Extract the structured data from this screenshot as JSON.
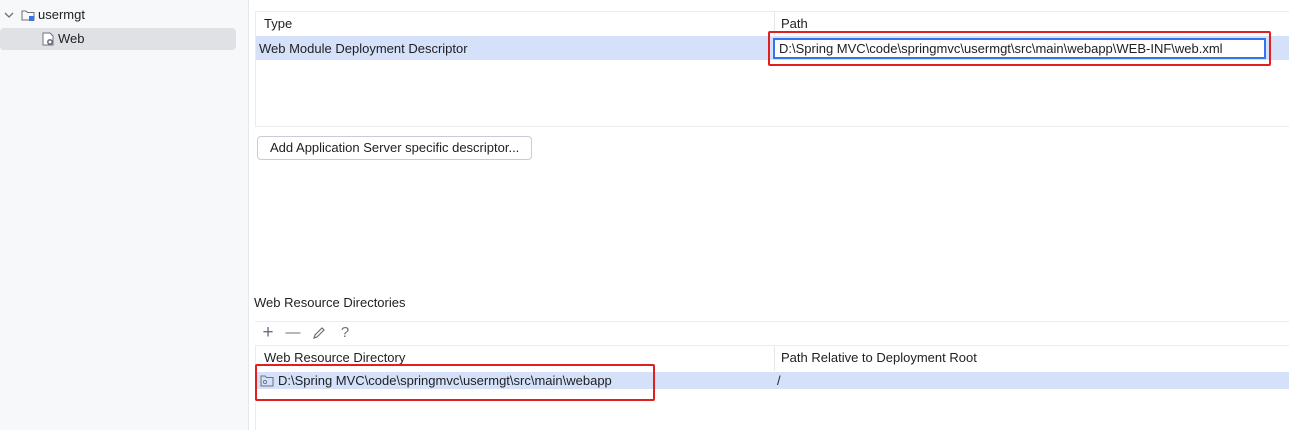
{
  "tree": {
    "items": [
      {
        "label": "usermgt",
        "icon": "module-folder-icon",
        "expanded": true
      },
      {
        "label": "Web",
        "icon": "web-facet-icon",
        "selected": true
      }
    ]
  },
  "descriptors": {
    "columns": [
      "Type",
      "Path"
    ],
    "rows": [
      {
        "type": "Web Module Deployment Descriptor",
        "path": "D:\\Spring MVC\\code\\springmvc\\usermgt\\src\\main\\webapp\\WEB-INF\\web.xml"
      }
    ],
    "add_button_label": "Add Application Server specific descriptor..."
  },
  "web_resources": {
    "section_title": "Web Resource Directories",
    "toolbar": {
      "add": "+",
      "remove": "—",
      "edit": "edit-icon",
      "help": "?"
    },
    "columns": [
      "Web Resource Directory",
      "Path Relative to Deployment Root"
    ],
    "rows": [
      {
        "directory": "D:\\Spring MVC\\code\\springmvc\\usermgt\\src\\main\\webapp",
        "relative_path": "/"
      }
    ]
  },
  "colors": {
    "selection": "#d5e1f8",
    "highlight_box": "#e02020",
    "focus_border": "#3574f0"
  }
}
